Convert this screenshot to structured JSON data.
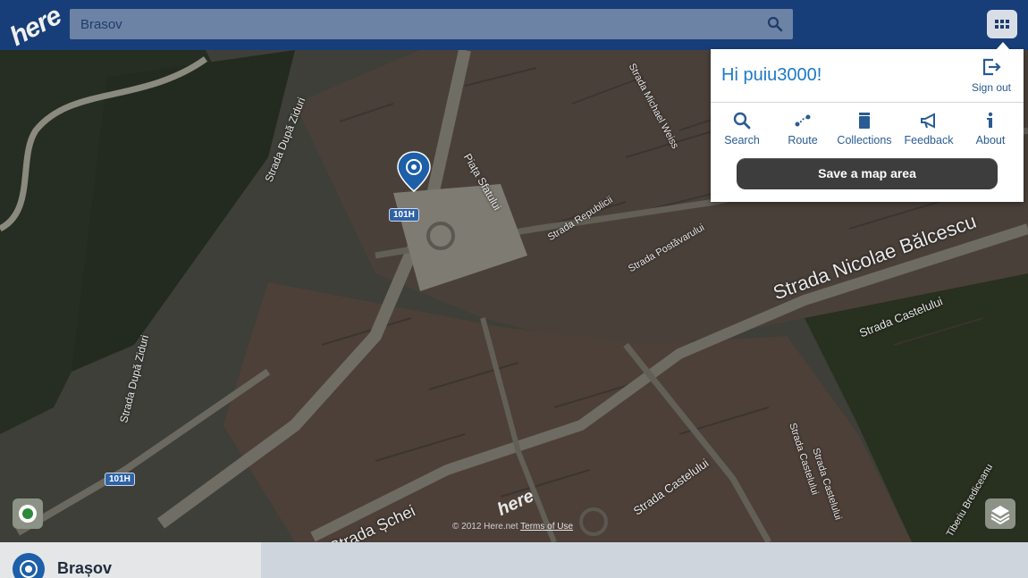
{
  "header": {
    "logo_text": "here",
    "search": {
      "value": "Brasov",
      "icon": "search-icon"
    },
    "apps_icon": "grid-icon"
  },
  "menu": {
    "greeting": "Hi puiu3000!",
    "signout_label": "Sign out",
    "items": [
      {
        "label": "Search",
        "icon": "search-icon"
      },
      {
        "label": "Route",
        "icon": "route-icon"
      },
      {
        "label": "Collections",
        "icon": "collections-icon"
      },
      {
        "label": "Feedback",
        "icon": "megaphone-icon"
      },
      {
        "label": "About",
        "icon": "info-icon"
      }
    ],
    "save_button_label": "Save a map area"
  },
  "map": {
    "streets": [
      "Strada După Ziduri",
      "Strada După Ziduri",
      "Strada Michael Weiss",
      "Piața Sfatului",
      "Strada Republicii",
      "Strada Postăvarului",
      "Strada Nicolae Bălcescu",
      "Strada Castelului",
      "Strada Castelului",
      "Strada Castelului",
      "Strada Castelului",
      "Strada Șchei",
      "Tiberiu Brediceanu"
    ],
    "road_shields": [
      "101H",
      "101H"
    ],
    "watermark": "here",
    "copyright": "© 2012 Here.net",
    "terms_label": "Terms of Use"
  },
  "bottom": {
    "place_name": "Brașov"
  },
  "colors": {
    "header_bg": "#173e78",
    "accent_blue": "#1c7ac6",
    "pin_blue": "#1d5fa8"
  }
}
